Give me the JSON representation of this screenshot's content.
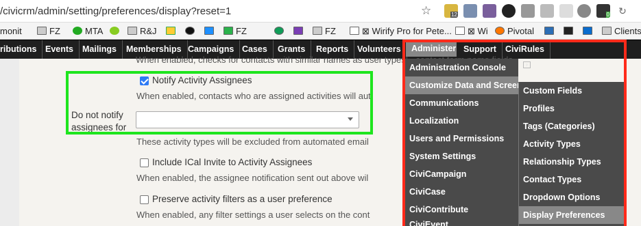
{
  "browser": {
    "url": "/civicrm/admin/setting/preferences/display?reset=1",
    "extension_badges": [
      "12",
      "0"
    ]
  },
  "bookmarks": [
    {
      "label": "monit"
    },
    {
      "label": "FZ"
    },
    {
      "label": "MTA"
    },
    {
      "label": "R&J"
    },
    {
      "label": "FZ"
    },
    {
      "label": "FZ"
    },
    {
      "label": "⊠ Wirify Pro for Pete..."
    },
    {
      "label": "⊠ Wi"
    },
    {
      "label": "Pivotal"
    },
    {
      "label": "Clients"
    }
  ],
  "nav": {
    "items": [
      "ributions",
      "Events",
      "Mailings",
      "Memberships",
      "Campaigns",
      "Cases",
      "Grants",
      "Reports",
      "Volunteers",
      "Administer",
      "Support",
      "CiviRules"
    ]
  },
  "form": {
    "top_text": "When enabled, checks for contacts with similar names as user types...   contact form name fields.",
    "notify_label": "Notify Activity Assignees",
    "notify_help": "When enabled, contacts who are assigned activities will aut",
    "do_not_notify_label_1": "Do not notify",
    "do_not_notify_label_2": "assignees for",
    "excluded_help": "These activity types will be excluded from automated email",
    "ical_label": "Include ICal Invite to Activity Assignees",
    "ical_help": "When enabled, the assignee notification sent out above wil",
    "preserve_label": "Preserve activity filters as a user preference",
    "preserve_help": "When enabled, any filter settings a user selects on the cont"
  },
  "admin_menu": {
    "items": [
      "Administration Console",
      "Customize Data and Screens",
      "Communications",
      "Localization",
      "Users and Permissions",
      "System Settings",
      "CiviCampaign",
      "CiviCase",
      "CiviContribute",
      "CiviEvent"
    ],
    "active": "Customize Data and Screens"
  },
  "submenu": {
    "items": [
      "Custom Fields",
      "Profiles",
      "Tags (Categories)",
      "Activity Types",
      "Relationship Types",
      "Contact Types",
      "Dropdown Options",
      "Display Preferences"
    ],
    "active": "Display Preferences"
  },
  "colors": {
    "highlight_green": "#1ee51e",
    "highlight_red": "#ff2a1a",
    "nav_bg": "#1f1f1f",
    "menu_bg": "#4a4a4a",
    "menu_hover": "#888888"
  }
}
